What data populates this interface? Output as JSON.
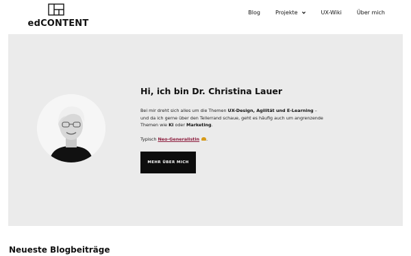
{
  "brand": {
    "name": "edCONTENT",
    "logo_icon": "layout-grid-icon"
  },
  "nav": {
    "items": [
      {
        "label": "Blog"
      },
      {
        "label": "Projekte",
        "has_dropdown": true
      },
      {
        "label": "UX-Wiki"
      },
      {
        "label": "Über mich"
      }
    ]
  },
  "hero": {
    "title": "Hi, ich bin Dr. Christina Lauer",
    "intro_1": "Bei mir dreht sich alles um die Themen ",
    "intro_bold_1": "UX-Design, Agilität und E-Learning",
    "intro_2": " – und da ich gerne über den Tellerrand schaue, geht es häufig auch um angrenzende Themen wie ",
    "intro_bold_2": "KI",
    "intro_3": " oder ",
    "intro_bold_3": "Marketing",
    "intro_4": ".",
    "typisch_prefix": "Typisch ",
    "typisch_link": "Neo-Generalistin",
    "typisch_suffix": ".",
    "cta_label": "MEHR ÜBER MICH",
    "background": "#ebebeb"
  },
  "section": {
    "title": "Neueste Blogbeiträge"
  }
}
